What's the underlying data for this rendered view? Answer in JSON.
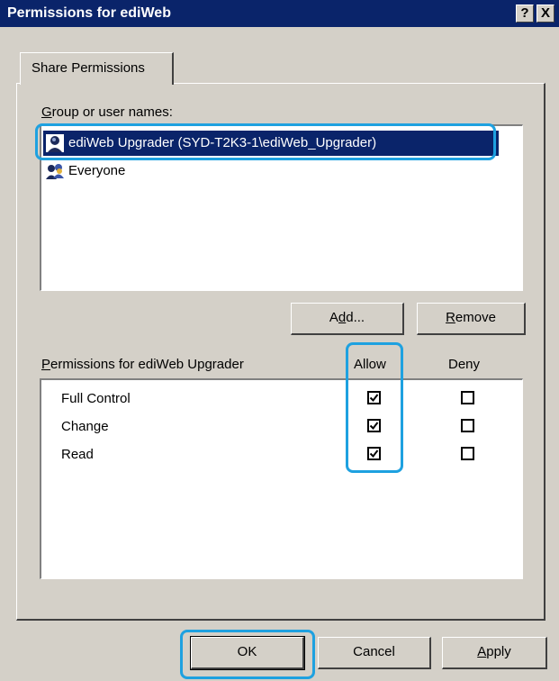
{
  "window": {
    "title": "Permissions for ediWeb",
    "help_button": "?",
    "close_button": "X"
  },
  "tabs": [
    {
      "label": "Share Permissions",
      "active": true
    }
  ],
  "group_section": {
    "label_underlined": "G",
    "label_rest": "roup or user names:",
    "items": [
      {
        "name": "ediWeb Upgrader (SYD-T2K3-1\\ediWeb_Upgrader)",
        "icon": "user-icon",
        "selected": true
      },
      {
        "name": "Everyone",
        "icon": "group-icon",
        "selected": false
      }
    ]
  },
  "buttons": {
    "add_pre": "A",
    "add_u": "d",
    "add_post": "d...",
    "remove_u": "R",
    "remove_rest": "emove",
    "ok": "OK",
    "cancel": "Cancel",
    "apply_u": "A",
    "apply_rest": "pply"
  },
  "permissions_section": {
    "label_underlined": "P",
    "label_rest": "ermissions for ediWeb Upgrader",
    "allow_header": "Allow",
    "deny_header": "Deny",
    "rows": [
      {
        "name": "Full Control",
        "allow": true,
        "deny": false
      },
      {
        "name": "Change",
        "allow": true,
        "deny": false
      },
      {
        "name": "Read",
        "allow": true,
        "deny": false
      }
    ]
  },
  "colors": {
    "dialog_face": "#d4d0c8",
    "title_bar": "#0a246a",
    "selection": "#0a246a",
    "annotation": "#1ea1e0"
  }
}
